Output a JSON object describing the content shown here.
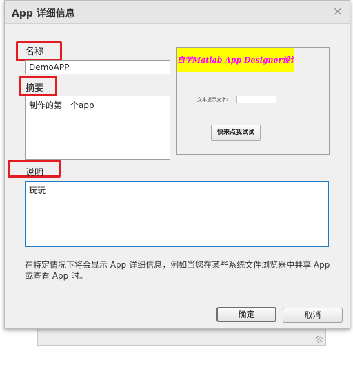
{
  "dialog": {
    "title": "App 详细信息",
    "close_glyph": "×"
  },
  "name_field": {
    "label": "名称",
    "value": "DemoAPP"
  },
  "summary_field": {
    "label": "摘要",
    "value": "制作的第一个app"
  },
  "description_field": {
    "label": "说明",
    "value": "玩玩"
  },
  "preview": {
    "banner_text": "自学Matlab App Designer设计",
    "text_label": "文本提示文字:",
    "button_label": "快来点我试试"
  },
  "info_text": "在特定情况下将会显示 App 详细信息，例如当您在某些系统文件浏览器中共享 App 或查看 App 时。",
  "buttons": {
    "ok": "确定",
    "cancel": "取消"
  },
  "colors": {
    "highlight_box": "#e31b23",
    "banner_background": "#ffff00",
    "banner_text": "#ff00ff",
    "focus_border": "#1e79c7"
  }
}
